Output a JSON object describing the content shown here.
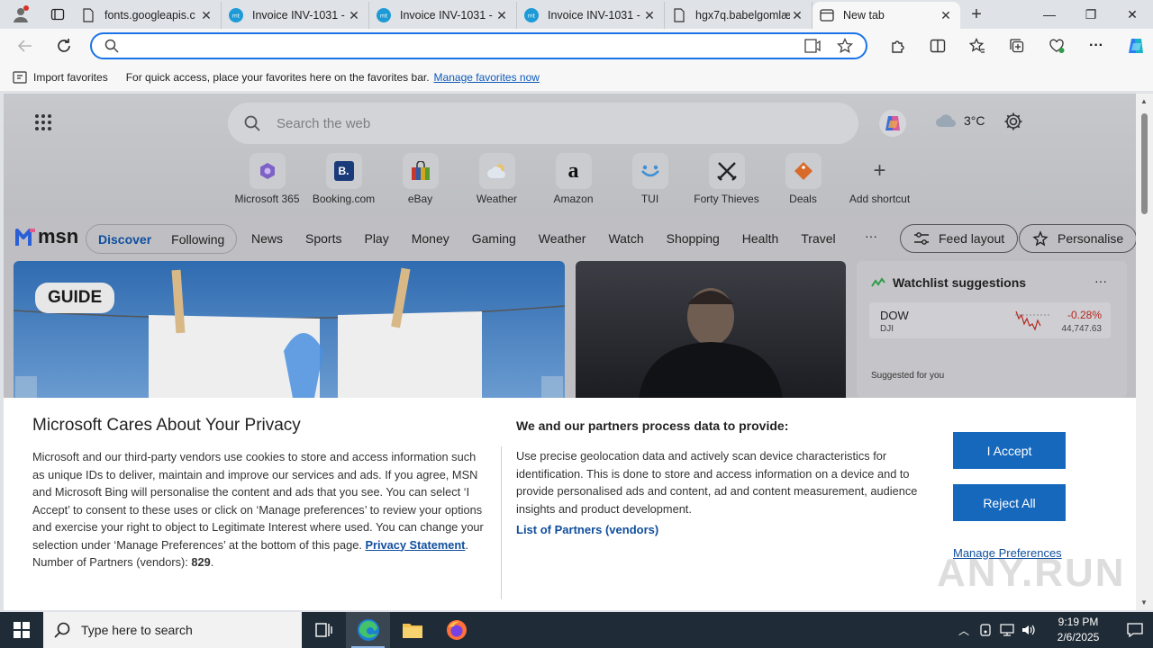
{
  "tabs": [
    {
      "title": "fonts.googleapis.c",
      "icon": "document-icon"
    },
    {
      "title": "Invoice INV-1031 -",
      "icon": "site-icon"
    },
    {
      "title": "Invoice INV-1031 -",
      "icon": "site-icon"
    },
    {
      "title": "Invoice INV-1031 -",
      "icon": "site-icon"
    },
    {
      "title": "hgx7q.babelgomlæ",
      "icon": "document-icon"
    },
    {
      "title": "New tab",
      "icon": "newtab-icon",
      "active": true
    }
  ],
  "address": {
    "value": "",
    "placeholder": ""
  },
  "favbar": {
    "import_label": "Import favorites",
    "message": "For quick access, place your favorites here on the favorites bar.",
    "link": "Manage favorites now"
  },
  "newtab": {
    "search_placeholder": "Search the web",
    "weather_temp": "3°C",
    "shortcuts": [
      {
        "label": "Microsoft 365"
      },
      {
        "label": "Booking.com"
      },
      {
        "label": "eBay"
      },
      {
        "label": "Weather"
      },
      {
        "label": "Amazon"
      },
      {
        "label": "TUI"
      },
      {
        "label": "Forty Thieves"
      },
      {
        "label": "Deals"
      },
      {
        "label": "Add shortcut"
      }
    ]
  },
  "msn": {
    "logo": "msn",
    "discover": "Discover",
    "following": "Following",
    "nav": [
      "News",
      "Sports",
      "Play",
      "Money",
      "Gaming",
      "Weather",
      "Watch",
      "Shopping",
      "Health",
      "Travel"
    ],
    "more": "···",
    "feed_layout": "Feed layout",
    "personalise": "Personalise",
    "guide_badge": "GUIDE",
    "watchlist": {
      "title": "Watchlist suggestions",
      "more": "···",
      "stock_symbol": "DOW",
      "stock_sub": "DJI",
      "stock_change": "-0.28%",
      "stock_value": "44,747.63",
      "suggested": "Suggested for you"
    }
  },
  "privacy": {
    "title": "Microsoft Cares About Your Privacy",
    "body": "Microsoft and our third-party vendors use cookies to store and access information such as unique IDs to deliver, maintain and improve our services and ads. If you agree, MSN and Microsoft Bing will personalise the content and ads that you see. You can select ‘I Accept’ to consent to these uses or click on ‘Manage preferences’ to review your options and exercise your right to object to Legitimate Interest where used. You can change your selection under ‘Manage Preferences’ at the bottom of this page.",
    "statement_link": "Privacy Statement",
    "partners_label": "Number of Partners (vendors):",
    "partners_count": "829",
    "heading2": "We and our partners process data to provide:",
    "body2": "Use precise geolocation data and actively scan device characteristics for identification. This is done to store and access information on a device and to provide personalised ads and content, ad and content measurement, audience insights and product development.",
    "partners_link": "List of Partners (vendors)",
    "accept": "I Accept",
    "reject": "Reject All",
    "manage": "Manage Preferences"
  },
  "watermark": "ANY.RUN",
  "taskbar": {
    "search_placeholder": "Type here to search",
    "time": "9:19 PM",
    "date": "2/6/2025"
  }
}
